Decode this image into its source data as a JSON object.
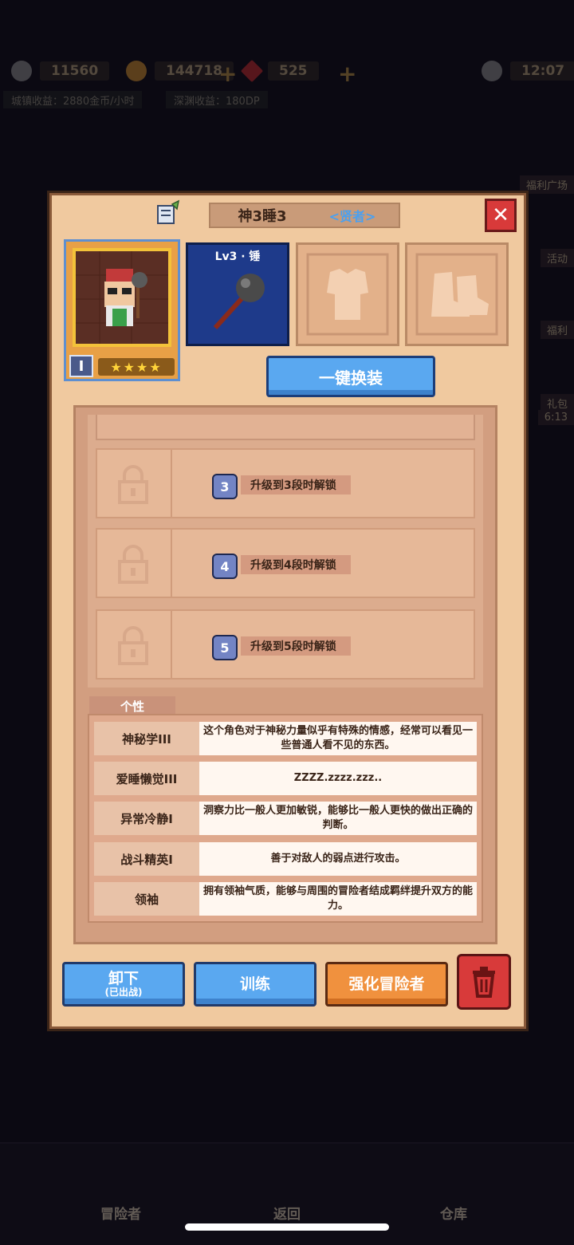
{
  "hud": {
    "resource_1": "11560",
    "resource_2": "144718",
    "resource_3": "525",
    "time": "12:07",
    "town_income": "城镇收益：2880金币/小时",
    "abyss_income": "深渊收益：180DP",
    "side_labels": [
      "福利广场",
      "活动",
      "福利",
      "礼包"
    ],
    "side_timer": "6:13",
    "nav": [
      "冒险者",
      "返回",
      "仓库"
    ]
  },
  "dialog": {
    "hero_name": "神3睡3",
    "hero_class": "<贤者>",
    "close_icon": "x-icon",
    "rank": "I",
    "stars": "★★★★",
    "weapon_label": "Lv3 · 锤",
    "one_key_equip": "一键换装",
    "skills": [
      {
        "badge": "3",
        "text": "升级到3段时解锁"
      },
      {
        "badge": "4",
        "text": "升级到4段时解锁"
      },
      {
        "badge": "5",
        "text": "升级到5段时解锁"
      }
    ],
    "trait_tab": "个性",
    "traits": [
      {
        "name": "神秘学III",
        "desc": "这个角色对于神秘力量似乎有特殊的情感，经常可以看见一些普通人看不见的东西。"
      },
      {
        "name": "爱睡懒觉III",
        "desc": "ZZZZ.zzzz.zzz.."
      },
      {
        "name": "异常冷静I",
        "desc": "洞察力比一般人更加敏锐，能够比一般人更快的做出正确的判断。"
      },
      {
        "name": "战斗精英I",
        "desc": "善于对敌人的弱点进行攻击。"
      },
      {
        "name": "领袖",
        "desc": "拥有领袖气质，能够与周围的冒险者结成羁绊提升双方的能力。"
      }
    ],
    "buttons": {
      "unequip": "卸下",
      "unequip_sub": "(已出战)",
      "train": "训练",
      "enhance": "强化冒险者"
    }
  },
  "colors": {
    "panel": "#f0c99f",
    "accent_blue": "#5aa8f0",
    "accent_orange": "#f0913e",
    "danger": "#d83a3a"
  }
}
